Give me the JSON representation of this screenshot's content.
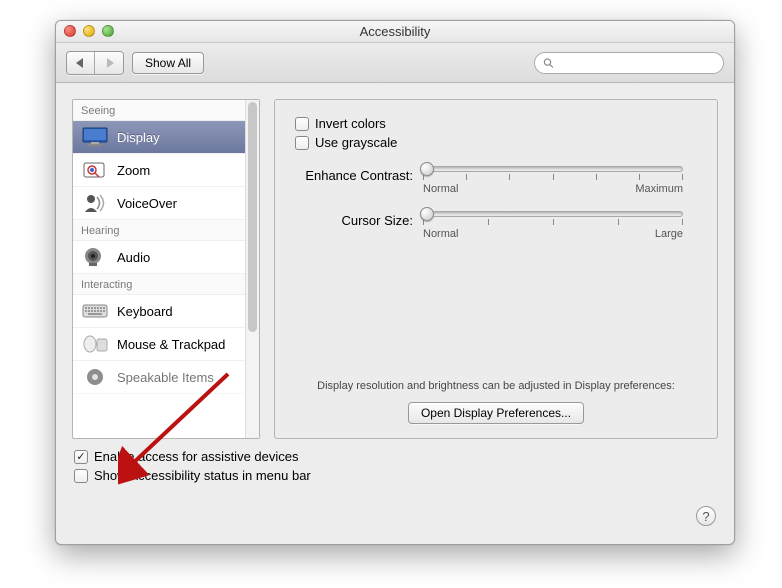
{
  "window": {
    "title": "Accessibility"
  },
  "toolbar": {
    "show_all": "Show All",
    "search_placeholder": ""
  },
  "sidebar": {
    "sections": {
      "seeing": "Seeing",
      "hearing": "Hearing",
      "interacting": "Interacting"
    },
    "items": {
      "display": "Display",
      "zoom": "Zoom",
      "voiceover": "VoiceOver",
      "audio": "Audio",
      "keyboard": "Keyboard",
      "mouse": "Mouse & Trackpad",
      "speakable": "Speakable Items"
    }
  },
  "detail": {
    "invert_colors": "Invert colors",
    "use_grayscale": "Use grayscale",
    "contrast_label": "Enhance Contrast:",
    "contrast_min": "Normal",
    "contrast_max": "Maximum",
    "cursor_label": "Cursor Size:",
    "cursor_min": "Normal",
    "cursor_max": "Large",
    "hint": "Display resolution and brightness can be adjusted in Display preferences:",
    "open_display": "Open Display Preferences..."
  },
  "footer": {
    "enable_assistive": "Enable access for assistive devices",
    "show_status": "Show Accessibility status in menu bar"
  }
}
